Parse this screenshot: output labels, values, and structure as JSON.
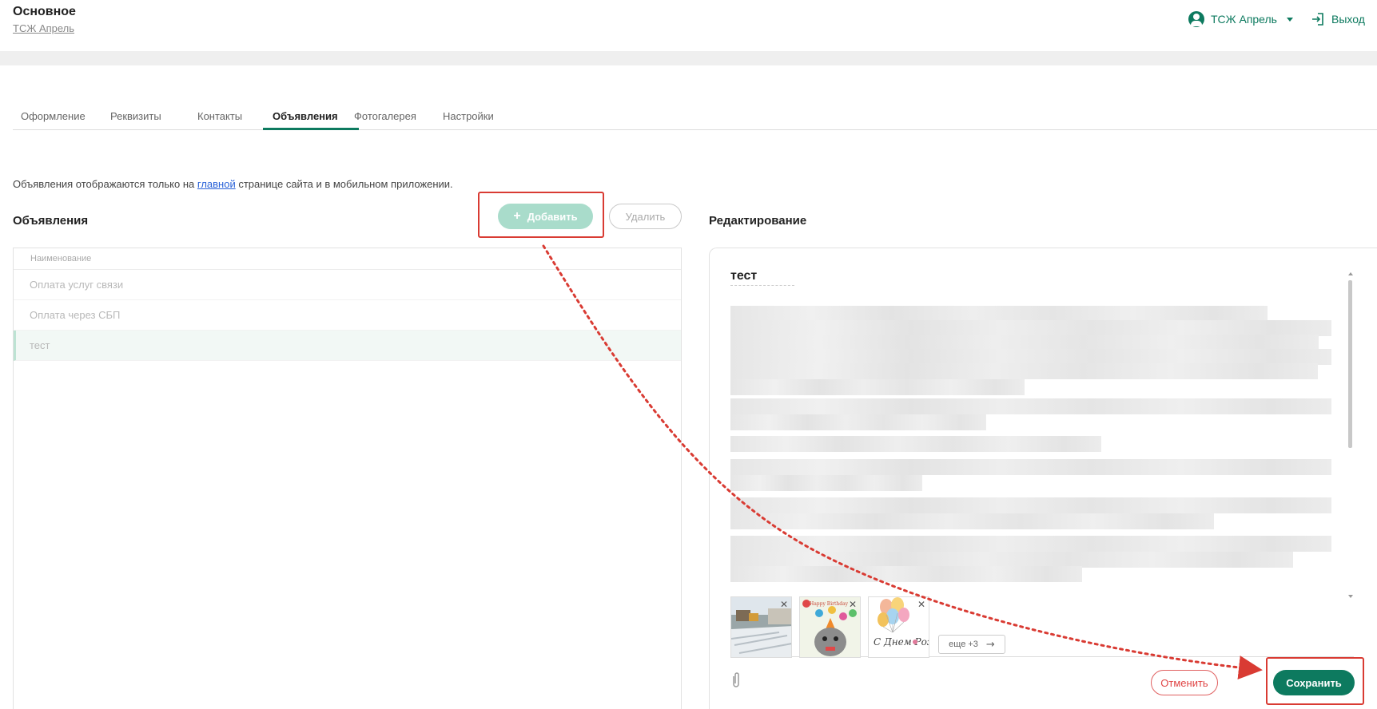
{
  "header": {
    "title": "Основное",
    "subtitle": "ТСЖ Апрель",
    "user_label": "ТСЖ Апрель",
    "logout_label": "Выход"
  },
  "tabs": [
    {
      "label": "Оформление",
      "active": false
    },
    {
      "label": "Реквизиты",
      "active": false
    },
    {
      "label": "Контакты",
      "active": false
    },
    {
      "label": "Объявления",
      "active": true
    },
    {
      "label": "Фотогалерея",
      "active": false
    },
    {
      "label": "Настройки",
      "active": false
    }
  ],
  "info": {
    "before": "Объявления отображаются только на ",
    "link": "главной",
    "after": " странице сайта и в мобильном приложении."
  },
  "list_section": {
    "title": "Объявления",
    "add_label": "Добавить",
    "delete_label": "Удалить",
    "column_header": "Наименование",
    "rows": [
      {
        "name": "Оплата услуг связи",
        "selected": false
      },
      {
        "name": "Оплата через СБП",
        "selected": false
      },
      {
        "name": "тест",
        "selected": true
      }
    ]
  },
  "editor": {
    "title": "Редактирование",
    "announcement_title": "тест",
    "more_label": "еще +3",
    "cancel_label": "Отменить",
    "save_label": "Сохранить",
    "thumb3_caption": "С Днем Рождения"
  },
  "colors": {
    "accent": "#0d7a5f",
    "annotation": "#d93b33",
    "add_button": "#a9dccb"
  }
}
